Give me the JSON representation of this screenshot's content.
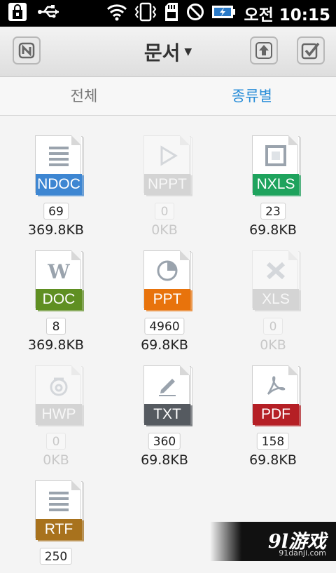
{
  "status_bar": {
    "clock": "오전 10:15",
    "icons": [
      "shopping-bag-icon",
      "usb-icon",
      "wifi-icon",
      "vibrate-icon",
      "sd-card-icon",
      "do-not-disturb-icon",
      "battery-charging-icon"
    ]
  },
  "title_bar": {
    "title": "문서",
    "left_icon": "n-app-icon",
    "upload_icon": "upload-icon",
    "check_icon": "checkbox-icon"
  },
  "tabs": [
    {
      "label": "전체",
      "active": false
    },
    {
      "label": "종류별",
      "active": true
    }
  ],
  "file_types": [
    {
      "label": "NDOC",
      "count": "69",
      "size": "369.8KB",
      "color": "#3d86d2",
      "glyph": "lines-icon",
      "enabled": true
    },
    {
      "label": "NPPT",
      "count": "0",
      "size": "0KB",
      "color": "#9a9a9a",
      "glyph": "play-icon",
      "enabled": false
    },
    {
      "label": "NXLS",
      "count": "23",
      "size": "69.8KB",
      "color": "#1ea35d",
      "glyph": "square-icon",
      "enabled": true
    },
    {
      "label": "DOC",
      "count": "8",
      "size": "369.8KB",
      "color": "#5f8f22",
      "glyph": "word-icon",
      "enabled": true
    },
    {
      "label": "PPT",
      "count": "4960",
      "size": "69.8KB",
      "color": "#e8730c",
      "glyph": "pie-icon",
      "enabled": true
    },
    {
      "label": "XLS",
      "count": "0",
      "size": "0KB",
      "color": "#9a9a9a",
      "glyph": "excel-icon",
      "enabled": false
    },
    {
      "label": "HWP",
      "count": "0",
      "size": "0KB",
      "color": "#9a9a9a",
      "glyph": "hangul-icon",
      "enabled": false
    },
    {
      "label": "TXT",
      "count": "360",
      "size": "69.8KB",
      "color": "#555a60",
      "glyph": "pencil-icon",
      "enabled": true
    },
    {
      "label": "PDF",
      "count": "158",
      "size": "69.8KB",
      "color": "#b51f25",
      "glyph": "acrobat-icon",
      "enabled": true
    },
    {
      "label": "RTF",
      "count": "250",
      "size": "",
      "color": "#a8721d",
      "glyph": "lines-icon",
      "enabled": true
    }
  ],
  "watermark": {
    "logo": "9l游戏",
    "url": "91danji.com"
  }
}
